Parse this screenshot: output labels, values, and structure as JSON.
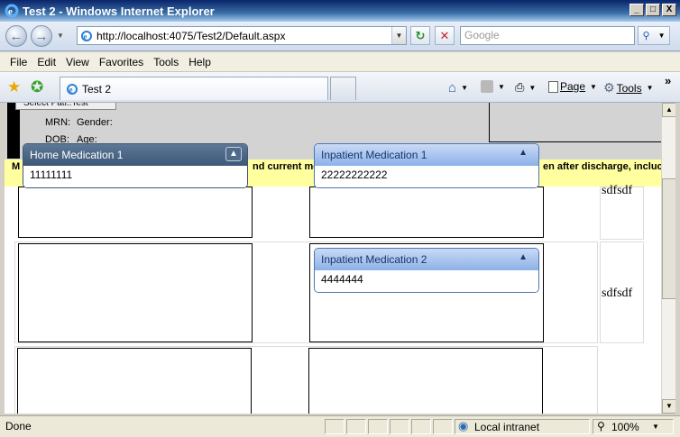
{
  "window": {
    "title": "Test 2 - Windows Internet Explorer",
    "buttons": {
      "minimize": "_",
      "maximize": "□",
      "close": "X"
    }
  },
  "address_bar": {
    "url": "http://localhost:4075/Test2/Default.aspx",
    "search_placeholder": "Google",
    "back_icon": "back-arrow-icon",
    "forward_icon": "forward-arrow-icon",
    "refresh_icon": "refresh-icon",
    "stop_icon": "stop-icon",
    "search_icon": "magnifier-icon"
  },
  "menu": {
    "items": [
      "File",
      "Edit",
      "View",
      "Favorites",
      "Tools",
      "Help"
    ]
  },
  "favorites_bar": {
    "tab_title": "Test 2",
    "page_label": "Page",
    "tools_label": "Tools",
    "overflow": "»"
  },
  "page": {
    "select_button_label": "Select Pati..Test",
    "mrn_label": "MRN:",
    "gender_label": "Gender:",
    "dob_label": "DOB:",
    "age_label": "Age:",
    "warning_left": "M",
    "warning_mid": "nd current me",
    "warning_right": "en after discharge, incluc",
    "side_text_1": "sdfsdf",
    "side_text_2": "sdfsdf"
  },
  "panels": [
    {
      "title": "Home Medication 1",
      "value": "11111111",
      "kind": "home"
    },
    {
      "title": "Inpatient Medication 1",
      "value": "22222222222",
      "kind": "inpatient"
    },
    {
      "title": "Inpatient Medication 2",
      "value": "4444444",
      "kind": "inpatient"
    }
  ],
  "status_bar": {
    "status": "Done",
    "zone": "Local intranet",
    "zoom": "100%"
  },
  "colors": {
    "warning_strip": "#ffffa0",
    "home_header": "#3d5878",
    "inpatient_header": "#8db1e9"
  }
}
